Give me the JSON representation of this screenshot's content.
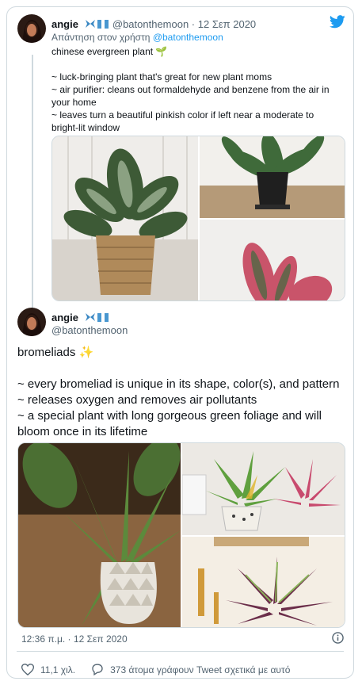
{
  "tweet1": {
    "name": "angie",
    "handle_time": "@batonthemoon · 12 Σεπ 2020",
    "reply_prefix": "Απάντηση στον χρήστη ",
    "reply_user": "@batonthemoon",
    "text": "chinese evergreen plant 🌱\n\n~ luck-bringing plant that's great for new plant moms\n~ air purifier: cleans out formaldehyde and benzene from the air in your home\n~ leaves turn a beautiful pinkish color if left near a moderate to bright-lit window"
  },
  "tweet2": {
    "name": "angie",
    "handle": "@batonthemoon",
    "text": "bromeliads ✨\n\n~ every bromeliad is unique in its shape, color(s), and pattern\n~ releases oxygen and removes air pollutants\n~ a special plant with long gorgeous green foliage and will bloom once in its lifetime",
    "timestamp": "12:36 π.μ. · 12 Σεπ 2020",
    "likes": "11,1 χιλ.",
    "discussion": "373 άτομα γράφουν Tweet σχετικά με αυτό"
  },
  "icons": {
    "brand": "twitter-bird-icon",
    "heart": "heart-icon",
    "reply": "reply-bubble-icon",
    "info": "info-icon"
  },
  "colors": {
    "brand": "#1d9bf0",
    "muted": "#536471",
    "border": "#cfd9de"
  }
}
